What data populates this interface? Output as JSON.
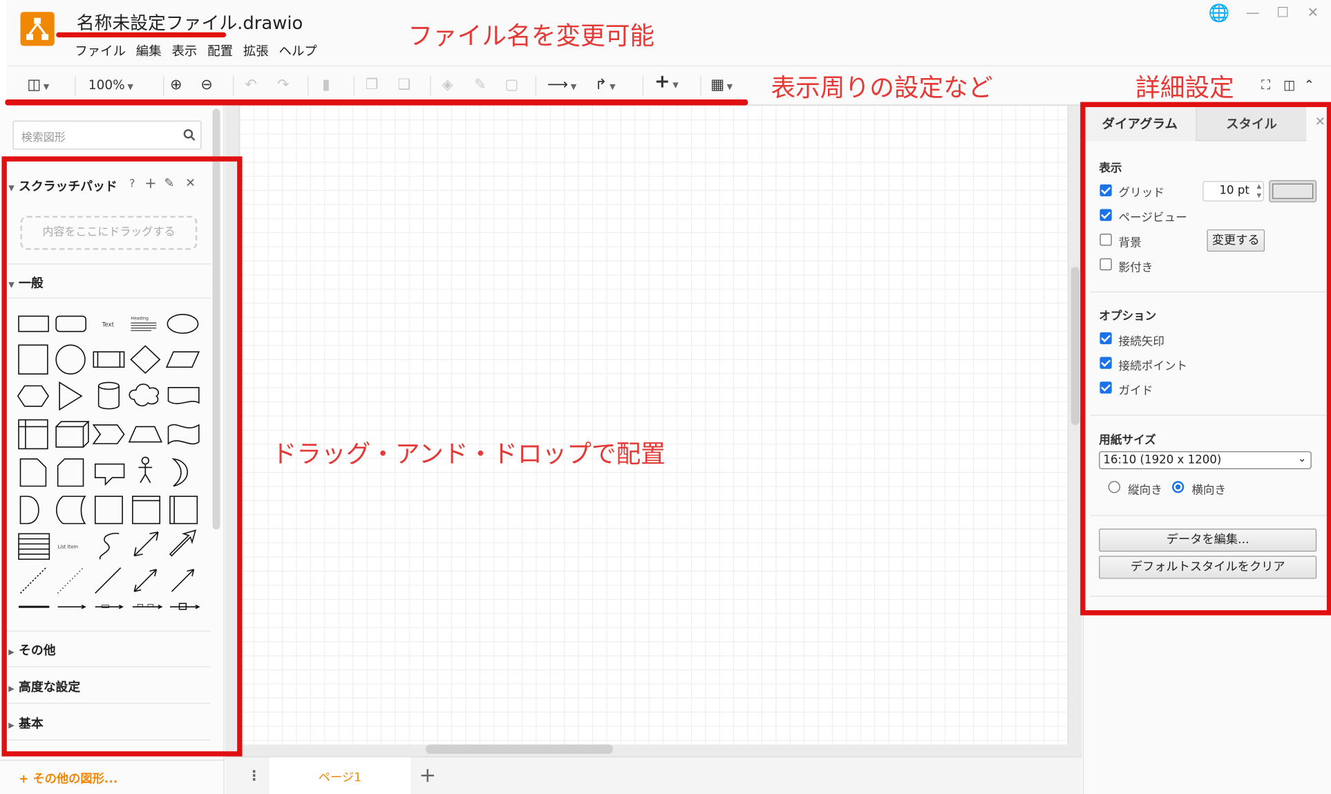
{
  "window": {
    "title": "名称未設定ファイル.drawio"
  },
  "menu": [
    "ファイル",
    "編集",
    "表示",
    "配置",
    "拡張",
    "ヘルプ"
  ],
  "toolbar": {
    "zoom": "100%"
  },
  "sidebar": {
    "search_placeholder": "検索図形",
    "scratchpad": {
      "title": "スクラッチパッド",
      "help": "?",
      "drop_hint": "内容をここにドラッグする"
    },
    "sections": [
      "一般",
      "その他",
      "高度な設定",
      "基本"
    ],
    "more_shapes": "+ その他の図形..."
  },
  "shape_labels": {
    "text": "Text",
    "heading": "Heading",
    "list_item": "List Item"
  },
  "pages": {
    "tab": "ページ1"
  },
  "format_panel": {
    "tabs": [
      "ダイアグラム",
      "スタイル"
    ],
    "view": {
      "title": "表示",
      "grid": {
        "label": "グリッド",
        "checked": true,
        "size": "10 pt"
      },
      "page_view": {
        "label": "ページビュー",
        "checked": true
      },
      "background": {
        "label": "背景",
        "checked": false,
        "button": "変更する"
      },
      "shadow": {
        "label": "影付き",
        "checked": false
      }
    },
    "options": {
      "title": "オプション",
      "items": [
        {
          "label": "接続矢印",
          "checked": true
        },
        {
          "label": "接続ポイント",
          "checked": true
        },
        {
          "label": "ガイド",
          "checked": true
        }
      ]
    },
    "paper": {
      "title": "用紙サイズ",
      "size": "16:10 (1920 x 1200)",
      "portrait": "縦向き",
      "landscape": "横向き",
      "orientation_selected": "横向き"
    },
    "buttons": {
      "edit_data": "データを編集...",
      "clear_default_style": "デフォルトスタイルをクリア"
    }
  },
  "annotations": {
    "filename": "ファイル名を変更可能",
    "toolbar": "表示周りの設定など",
    "details": "詳細設定",
    "canvas": "ドラッグ・アンド・ドロップで配置"
  },
  "colors": {
    "accent": "#f08705",
    "annotation": "#e01010",
    "checkbox": "#1a73e8"
  }
}
